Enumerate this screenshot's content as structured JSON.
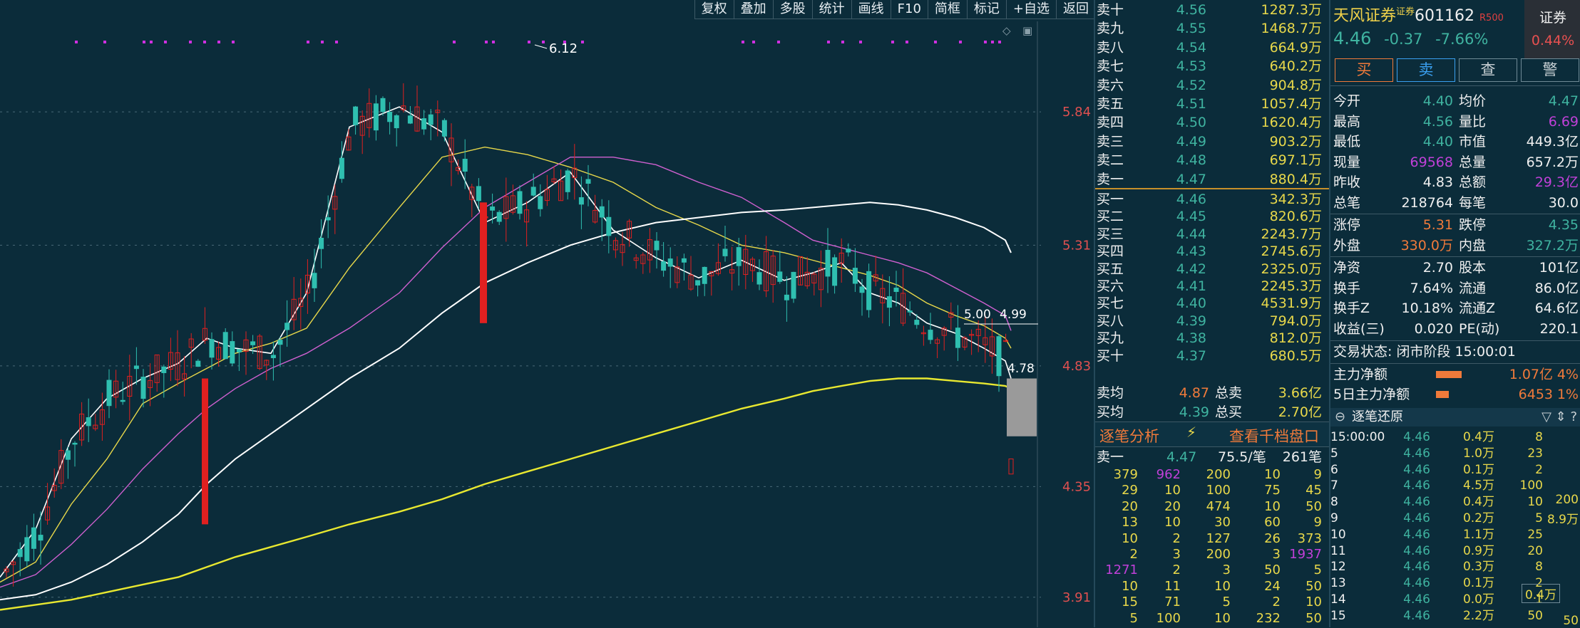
{
  "toolbar": {
    "items": [
      "复权",
      "叠加",
      "多股",
      "统计",
      "画线",
      "F10",
      "简框",
      "标记",
      "+自选",
      "返回"
    ]
  },
  "chart": {
    "y_labels": [
      "5.84",
      "5.31",
      "4.83",
      "4.35",
      "3.91"
    ],
    "annotations": {
      "high": "6.12",
      "ma_a": "5.00",
      "ma_b": "4.99",
      "last": "4.78"
    },
    "colors": {
      "up": "#e02020",
      "down": "#2fbfb0",
      "ma5": "#ffffff",
      "ma10": "#e8d84a",
      "ma20": "#d060d0",
      "ma60": "#ffffff",
      "ma250": "#e8e830"
    },
    "ranges": {
      "ymin": 3.85,
      "ymax": 6.2
    }
  },
  "chart_data": {
    "type": "candlestick",
    "title": "",
    "y_ticks": [
      5.84,
      5.31,
      4.83,
      4.35,
      3.91
    ],
    "ylim": [
      3.85,
      6.2
    ],
    "grid": "horizontal dashed",
    "annotated_values": {
      "period_high": 6.12,
      "last_close": 4.78
    },
    "series": [
      {
        "values": [
          3.99,
          4.18,
          4.54,
          4.7,
          4.78,
          4.84,
          4.94,
          4.9,
          4.88,
          5.12,
          5.78,
          5.86,
          5.76,
          5.4,
          5.48,
          5.6,
          5.37,
          5.26,
          5.18,
          5.25,
          5.17,
          5.2,
          5.24,
          5.12,
          5.08,
          5.0,
          4.96,
          4.9,
          4.85,
          4.78
        ]
      },
      {
        "values": [
          3.97,
          4.05,
          4.28,
          4.46,
          4.68,
          4.76,
          4.82,
          4.88,
          4.92,
          4.98,
          5.22,
          5.46,
          5.66,
          5.7,
          5.67,
          5.62,
          5.56,
          5.46,
          5.39,
          5.31,
          5.28,
          5.25,
          5.22,
          5.19,
          5.15,
          5.08,
          5.03,
          4.99,
          4.94,
          4.9
        ]
      },
      {
        "values": [
          3.95,
          4.0,
          4.12,
          4.26,
          4.42,
          4.56,
          4.66,
          4.74,
          4.82,
          4.88,
          4.98,
          5.12,
          5.3,
          5.46,
          5.56,
          5.66,
          5.66,
          5.63,
          5.56,
          5.5,
          5.4,
          5.33,
          5.3,
          5.27,
          5.24,
          5.2,
          5.14,
          5.08,
          5.03,
          4.97
        ]
      },
      {
        "values": [
          3.9,
          3.92,
          3.97,
          4.04,
          4.13,
          4.24,
          4.36,
          4.46,
          4.56,
          4.66,
          4.78,
          4.9,
          5.04,
          5.16,
          5.24,
          5.31,
          5.36,
          5.4,
          5.42,
          5.44,
          5.45,
          5.46,
          5.47,
          5.48,
          5.47,
          5.45,
          5.42,
          5.38,
          5.33,
          5.28
        ]
      },
      {
        "values": [
          3.86,
          3.88,
          3.9,
          3.93,
          3.96,
          3.99,
          4.03,
          4.07,
          4.11,
          4.15,
          4.2,
          4.25,
          4.3,
          4.36,
          4.41,
          4.46,
          4.51,
          4.56,
          4.61,
          4.66,
          4.7,
          4.73,
          4.75,
          4.77,
          4.78,
          4.78,
          4.77,
          4.76,
          4.75,
          4.74
        ]
      }
    ]
  },
  "orderbook": {
    "asks": [
      {
        "label": "卖十",
        "px": "4.56",
        "vol": "1287.3万",
        "mark": "¥"
      },
      {
        "label": "卖九",
        "px": "4.55",
        "vol": "1468.7万"
      },
      {
        "label": "卖八",
        "px": "4.54",
        "vol": "664.9万"
      },
      {
        "label": "卖七",
        "px": "4.53",
        "vol": "640.2万"
      },
      {
        "label": "卖六",
        "px": "4.52",
        "vol": "904.8万"
      },
      {
        "label": "卖五",
        "px": "4.51",
        "vol": "1057.4万"
      },
      {
        "label": "卖四",
        "px": "4.50",
        "vol": "1620.4万"
      },
      {
        "label": "卖三",
        "px": "4.49",
        "vol": "903.2万"
      },
      {
        "label": "卖二",
        "px": "4.48",
        "vol": "697.1万"
      },
      {
        "label": "卖一",
        "px": "4.47",
        "vol": "880.4万"
      }
    ],
    "bids": [
      {
        "label": "买一",
        "px": "4.46",
        "vol": "342.3万"
      },
      {
        "label": "买二",
        "px": "4.45",
        "vol": "820.6万"
      },
      {
        "label": "买三",
        "px": "4.44",
        "vol": "2243.7万"
      },
      {
        "label": "买四",
        "px": "4.43",
        "vol": "2745.6万"
      },
      {
        "label": "买五",
        "px": "4.42",
        "vol": "2325.0万"
      },
      {
        "label": "买六",
        "px": "4.41",
        "vol": "2245.3万"
      },
      {
        "label": "买七",
        "px": "4.40",
        "vol": "4531.9万"
      },
      {
        "label": "买八",
        "px": "4.39",
        "vol": "794.0万"
      },
      {
        "label": "买九",
        "px": "4.38",
        "vol": "812.0万"
      },
      {
        "label": "买十",
        "px": "4.37",
        "vol": "680.5万"
      }
    ],
    "summary": [
      {
        "l1": "卖均",
        "v1": "4.87",
        "l2": "总卖",
        "v2": "3.66亿"
      },
      {
        "l1": "买均",
        "v1": "4.39",
        "l2": "总买",
        "v2": "2.70亿"
      }
    ]
  },
  "ticks": {
    "title": "逐笔分析",
    "link": "查看千档盘口",
    "summary": {
      "label": "卖一",
      "px": "4.47",
      "avg": "75.5/笔",
      "count": "261笔"
    },
    "rows": [
      [
        "379",
        "962",
        "200",
        "10",
        "9"
      ],
      [
        "29",
        "10",
        "100",
        "75",
        "45"
      ],
      [
        "20",
        "20",
        "474",
        "10",
        "50"
      ],
      [
        "13",
        "10",
        "30",
        "60",
        "9"
      ],
      [
        "10",
        "2",
        "127",
        "26",
        "373"
      ],
      [
        "2",
        "3",
        "200",
        "3",
        "1937"
      ],
      [
        "1271",
        "2",
        "3",
        "50",
        "5"
      ],
      [
        "10",
        "11",
        "10",
        "24",
        "50"
      ],
      [
        "15",
        "71",
        "5",
        "2",
        "10"
      ],
      [
        "5",
        "100",
        "10",
        "232",
        "50"
      ]
    ],
    "purple_cells": [
      "962",
      "1937",
      "1271"
    ]
  },
  "quote": {
    "name": "天风证券",
    "sup": "证券",
    "code": "601162",
    "r500": "R500",
    "badge": "证券",
    "badge_pct": "0.44%",
    "price": "4.46",
    "change": "-0.37",
    "pct": "-7.66%",
    "buttons": [
      "买",
      "卖",
      "查",
      "警"
    ],
    "rows": [
      {
        "a": "今开",
        "av": "4.40",
        "ac": "#3fb3a0",
        "b": "均价",
        "bv": "4.47",
        "bc": "#3fb3a0"
      },
      {
        "a": "最高",
        "av": "4.56",
        "ac": "#3fb3a0",
        "b": "量比",
        "bv": "6.69",
        "bc": "#c040d8"
      },
      {
        "a": "最低",
        "av": "4.40",
        "ac": "#3fb3a0",
        "b": "市值",
        "bv": "449.3亿",
        "bc": "#f0f0f0"
      },
      {
        "a": "现量",
        "av": "69568",
        "ac": "#c040d8",
        "b": "总量",
        "bv": "657.2万",
        "bc": "#f0f0f0"
      },
      {
        "a": "昨收",
        "av": "4.83",
        "ac": "#f0f0f0",
        "b": "总额",
        "bv": "29.3亿",
        "bc": "#c040d8"
      },
      {
        "a": "总笔",
        "av": "218764",
        "ac": "#f0f0f0",
        "b": "每笔",
        "bv": "30.0",
        "bc": "#f0f0f0"
      }
    ],
    "rows2": [
      {
        "a": "涨停",
        "av": "5.31",
        "ac": "#f07a3a",
        "b": "跌停",
        "bv": "4.35",
        "bc": "#3fb3a0"
      },
      {
        "a": "外盘",
        "av": "330.0万",
        "ac": "#f07a3a",
        "b": "内盘",
        "bv": "327.2万",
        "bc": "#3fb3a0"
      }
    ],
    "rows3": [
      {
        "a": "净资",
        "av": "2.70",
        "ac": "#f0f0f0",
        "b": "股本",
        "bv": "101亿",
        "bc": "#f0f0f0"
      },
      {
        "a": "换手",
        "av": "7.64%",
        "ac": "#f0f0f0",
        "b": "流通",
        "bv": "86.0亿",
        "bc": "#f0f0f0"
      },
      {
        "a": "换手Z",
        "av": "10.18%",
        "ac": "#f0f0f0",
        "b": "流通Z",
        "bv": "64.6亿",
        "bc": "#f0f0f0"
      },
      {
        "a": "收益(三)",
        "av": "0.020",
        "ac": "#f0f0f0",
        "b": "PE(动)",
        "bv": "220.1",
        "bc": "#f0f0f0"
      }
    ],
    "status": "交易状态: 闭市阶段 15:00:01",
    "flow": [
      {
        "label": "主力净额",
        "value": "1.07亿",
        "pct": "4%",
        "bar": 0.8
      },
      {
        "label": "5日主力净额",
        "value": "6453万",
        "pct": "1%",
        "bar": 0.4
      }
    ]
  },
  "subticks": {
    "title": "逐笔还原",
    "rows": [
      [
        "15:00:00",
        "4.46",
        "0.4万",
        "8"
      ],
      [
        "5",
        "4.46",
        "1.0万",
        "23"
      ],
      [
        "6",
        "4.46",
        "0.1万",
        "2"
      ],
      [
        "7",
        "4.46",
        "4.5万",
        "100"
      ],
      [
        "8",
        "4.46",
        "0.4万",
        "10"
      ],
      [
        "9",
        "4.46",
        "0.2万",
        "5"
      ],
      [
        "10",
        "4.46",
        "1.1万",
        "25"
      ],
      [
        "11",
        "4.46",
        "0.9万",
        "20"
      ],
      [
        "12",
        "4.46",
        "0.3万",
        "8"
      ],
      [
        "13",
        "4.46",
        "0.1万",
        "2"
      ],
      [
        "14",
        "4.46",
        "0.0万",
        "1"
      ],
      [
        "15",
        "4.46",
        "2.2万",
        "50"
      ]
    ],
    "side": [
      {
        "v": "200"
      },
      {
        "v": "8.9万"
      },
      {
        "v": "0.4万"
      },
      {
        "v": "50"
      }
    ]
  }
}
